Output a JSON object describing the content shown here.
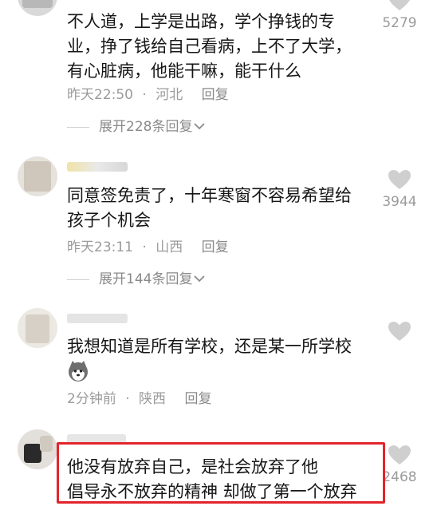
{
  "comments": [
    {
      "text": "不人道，上学是出路，学个挣钱的专\n业，挣了钱给自己看病，上不了大学，\n有心脏病，他能干嘛，能干什么",
      "time": "昨天22:50",
      "location": "河北",
      "reply_label": "回复",
      "expand_label": "展开228条回复",
      "likes": "5279"
    },
    {
      "text": "同意签免责了，十年寒窗不容易希望给\n孩子个机会",
      "time": "昨天23:11",
      "location": "山西",
      "reply_label": "回复",
      "expand_label": "展开144条回复",
      "likes": "3944"
    },
    {
      "text": "我想知道是所有学校，还是某一所学校",
      "emoji": "husky-emoji",
      "time": "2分钟前",
      "location": "陕西",
      "reply_label": "回复",
      "likes": ""
    },
    {
      "text": "他没有放弃自己，是社会放弃了他\n倡导永不放弃的精神 却做了第一个放弃",
      "likes": "2468"
    }
  ],
  "separator": "·",
  "chevron": "⌄",
  "colors": {
    "highlight_border": "#e3242b",
    "meta_gray": "#9b9b9b",
    "heart_gray": "#cfcfcf"
  },
  "icons": {
    "like": "heart-icon",
    "expand": "chevron-down-icon"
  }
}
